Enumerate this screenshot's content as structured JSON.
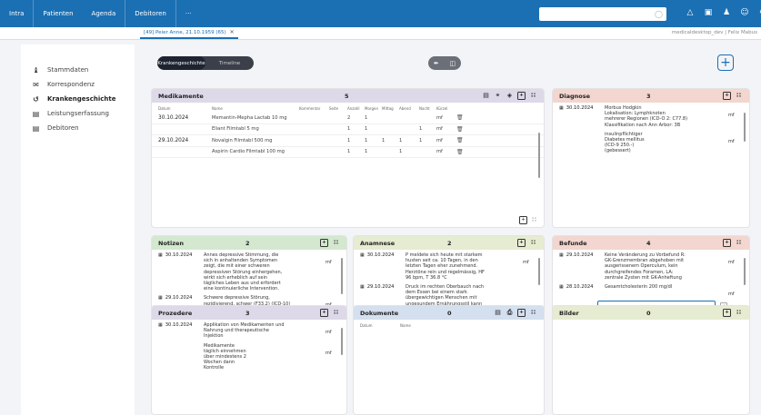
{
  "topbar": {
    "nav": [
      "Intra",
      "Patienten",
      "Agenda",
      "Debitoren",
      "···"
    ],
    "search_placeholder": "",
    "icons": [
      "bell-icon",
      "calendar-icon",
      "users-icon",
      "user-icon",
      "settings-icon"
    ]
  },
  "tabbar": {
    "tab_label": "[49] Peier Anne, 21.10.1959 (65)",
    "close": "✕",
    "account": "medicaldesktop_dev | Felix Mabus"
  },
  "sidebar": {
    "items": [
      {
        "label": "Stammdaten",
        "icon": "person-icon"
      },
      {
        "label": "Korrespondenz",
        "icon": "mail-icon"
      },
      {
        "label": "Krankengeschichte",
        "icon": "history-icon",
        "active": true
      },
      {
        "label": "Leistungserfassung",
        "icon": "document-icon"
      },
      {
        "label": "Debitoren",
        "icon": "document-icon"
      }
    ]
  },
  "toolbar": {
    "toggle": [
      "Krankengeschichte",
      "Timeline"
    ],
    "add": "+"
  },
  "medikamente": {
    "title": "Medikamente",
    "count": "5",
    "headers": [
      "Datum",
      "Name",
      "Kommentar",
      "Seite",
      "Anzahl",
      "Morgen",
      "Mittag",
      "Abend",
      "Nacht",
      "Kürzel"
    ],
    "rows": [
      {
        "date": "30.10.2024",
        "name": "Memantin-Mepha Lactab 10 mg",
        "comment": "",
        "seite": "",
        "anzahl": "2",
        "morgen": "1",
        "mittag": "",
        "abend": "",
        "nacht": "",
        "kuerzel": "mf"
      },
      {
        "date": "",
        "name": "Eliant Filmtabl 5 mg",
        "comment": "",
        "seite": "",
        "anzahl": "1",
        "morgen": "1",
        "mittag": "",
        "abend": "",
        "nacht": "1",
        "kuerzel": "mf"
      },
      {
        "date": "29.10.2024",
        "name": "Novalgin Filmtabl 500 mg",
        "comment": "",
        "seite": "",
        "anzahl": "1",
        "morgen": "1",
        "mittag": "1",
        "abend": "1",
        "nacht": "1",
        "kuerzel": "mf"
      },
      {
        "date": "",
        "name": "Aspirin Cardio Filmtabl 100 mg",
        "comment": "",
        "seite": "",
        "anzahl": "1",
        "morgen": "1",
        "mittag": "",
        "abend": "1",
        "nacht": "",
        "kuerzel": "mf"
      }
    ]
  },
  "diagnose": {
    "title": "Diagnose",
    "count": "3",
    "entries": [
      {
        "date": "30.10.2024",
        "lines": [
          "Morbus Hodgkin",
          "Lokalisation: Lymphknoten",
          "mehrerer Regionen (ICD-O 2: C77.8)",
          "Klassifikation nach Ann Arbor: 3B"
        ],
        "user": "mf"
      },
      {
        "date": "",
        "lines": [
          "insulinpflichtiger",
          "Diabetes mellitus",
          "(ICD-9 250.-)",
          "(gebessert)"
        ],
        "user": "mf"
      }
    ]
  },
  "notizen": {
    "title": "Notizen",
    "count": "2",
    "entries": [
      {
        "date": "30.10.2024",
        "lines": [
          "Annes depressive Stimmung, die",
          "sich in anhaltenden Symptomen",
          "zeigt, die mit einer schweren",
          "depressiven Störung einhergehen,",
          "wirkt sich erheblich auf sein",
          "tägliches Leben aus und erfordert",
          "eine kontinuierliche Intervention."
        ],
        "user": "mf"
      },
      {
        "date": "29.10.2024",
        "lines": [
          "Schwere depressive Störung,",
          "rezidivierend, schwer (F33.2) (ICD-10)"
        ],
        "user": "mf"
      }
    ]
  },
  "anamnese": {
    "title": "Anamnese",
    "count": "2",
    "entries": [
      {
        "date": "30.10.2024",
        "lines": [
          "P meldete sich heute mit starkem",
          "husten seit ca. 10 Tagen, in den",
          "letzten Tagen eher zunehmend.",
          "Herztöne rein und regelmässig, HF",
          "96 bpm, T 36.8 °C"
        ],
        "user": "mf"
      },
      {
        "date": "29.10.2024",
        "lines": [
          "Druck im rechten Oberbauch nach",
          "dem Essen bei einem stark",
          "übergewichtigen Menschen mit",
          "ungesundem Ernährungsstil kann"
        ],
        "user": ""
      }
    ]
  },
  "befunde": {
    "title": "Befunde",
    "count": "4",
    "entries": [
      {
        "date": "29.10.2024",
        "lines": [
          "Keine Veränderung zu Vorbefund R:",
          "GK-Grenzmembran abgehoben mit",
          "ausgerissenem Operculum, kein",
          "durchgreifendes Foramen, LA:",
          "zentrale Zysten mit GK-Anheftung"
        ],
        "user": "mf"
      },
      {
        "date": "28.10.2024",
        "lines": [
          "Gesamtcholesterin 200 mg/dl"
        ],
        "user": "mf"
      }
    ],
    "input_value": ""
  },
  "prozedere": {
    "title": "Prozedere",
    "count": "3",
    "entries": [
      {
        "date": "30.10.2024",
        "lines": [
          "Applikation von Medikamenten und",
          "Nahrung und therapeutische",
          "Injektion"
        ],
        "user": "mf"
      },
      {
        "date": "",
        "lines": [
          "Medikamente",
          "täglich einnehmen",
          "über mindestens 2",
          "Wochen dann",
          "Kontrolle"
        ],
        "user": "mf"
      }
    ]
  },
  "dokumente": {
    "title": "Dokumente",
    "count": "0",
    "headers": [
      "Datum",
      "Name"
    ]
  },
  "bilder": {
    "title": "Bilder",
    "count": "0"
  },
  "colors": {
    "topbar": "#1b6fb3",
    "medikamente_head": "#ddd9e8",
    "diagnose_head": "#f3d6cf",
    "notizen_head": "#d3e8cf",
    "anamnese_head": "#e6ecd1",
    "befunde_head": "#f3d6cf",
    "prozedere_head": "#ddd9e8",
    "dokumente_head": "#d4dfef",
    "bilder_head": "#e6ecd1"
  }
}
